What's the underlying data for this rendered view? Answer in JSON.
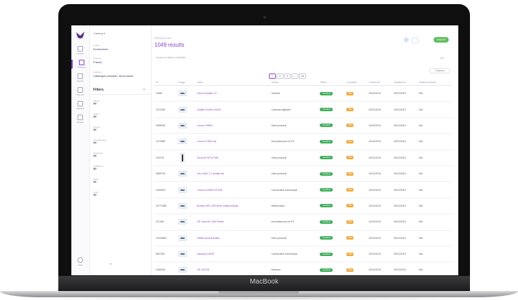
{
  "device": {
    "brand": "MacBook"
  },
  "rail": {
    "items": [
      {
        "label": "Activity",
        "icon": "activity-icon"
      },
      {
        "label": "Products",
        "icon": "products-icon"
      },
      {
        "label": "Imports",
        "icon": "imports-icon"
      },
      {
        "label": "Exports",
        "icon": "exports-icon"
      },
      {
        "label": "Settings",
        "icon": "gear-icon"
      },
      {
        "label": "System",
        "icon": "system-icon"
      }
    ],
    "help": "Help"
  },
  "sidebar": {
    "catalog": "Catalog",
    "locale_label": "Locale",
    "locale_value": "Ecommerce",
    "channel_label": "Channel",
    "channel_value": "France",
    "category_label": "Category",
    "category_value": "Catalogue principal / All products",
    "filters_title": "Filters",
    "filters_reset": "✕",
    "filters": [
      {
        "name": "Family",
        "value": "All"
      },
      {
        "name": "Status",
        "value": "All"
      },
      {
        "name": "Groups",
        "value": "All"
      },
      {
        "name": "Completeness",
        "value": "All"
      },
      {
        "name": "Created at",
        "value": "All"
      },
      {
        "name": "Updated at",
        "value": "All"
      },
      {
        "name": "Label",
        "value": "All"
      },
      {
        "name": "Color",
        "value": "All"
      }
    ]
  },
  "header": {
    "breadcrumb": "PRODUCTS",
    "results": "1049 results",
    "create_label": "CREATE",
    "search_placeholder": "Search on label or identifier",
    "locale": "EN",
    "columns_label": "Columns",
    "pages": [
      "1",
      "2",
      "3",
      "...",
      "44"
    ]
  },
  "table": {
    "columns": [
      "ID",
      "Image",
      "Label",
      "Family",
      "Status",
      "Complete",
      "Created at",
      "Updated at",
      "Variant products"
    ],
    "rows": [
      {
        "id": "19587",
        "label": "Sony Docsillon C2",
        "family": "Scanner",
        "status": "Enabled",
        "complete": "28%",
        "created": "09/12/2019",
        "updated": "09/12/2019",
        "variant": "N/A",
        "thumb": "wide"
      },
      {
        "id": "1372284",
        "label": "Fujifilm FinePix S4200",
        "family": "Cameras digitales",
        "status": "Enabled",
        "complete": "28%",
        "created": "09/12/2019",
        "updated": "09/12/2019",
        "variant": "N/A",
        "thumb": "wide"
      },
      {
        "id": "9356255",
        "label": "Lenovo V560X",
        "family": "Hard products",
        "status": "Enabled",
        "complete": "28%",
        "created": "09/12/2019",
        "updated": "09/12/2019",
        "variant": "N/A",
        "thumb": "wide"
      },
      {
        "id": "1374380",
        "label": "Lenovo E.550 Lite",
        "family": "Innovation pen for PC",
        "status": "Enabled",
        "complete": "28%",
        "created": "09/12/2019",
        "updated": "09/12/2019",
        "variant": "N/A",
        "thumb": "wide"
      },
      {
        "id": "132278",
        "label": "Sony SE-SP1XT4W",
        "family": "Hard products",
        "status": "Enabled",
        "complete": "28%",
        "created": "09/12/2019",
        "updated": "09/12/2019",
        "variant": "N/A",
        "thumb": "tall"
      },
      {
        "id": "9089703",
        "label": "Zero 400e 2.1 double-del",
        "family": "Hard products",
        "status": "Enabled",
        "complete": "28%",
        "created": "09/12/2019",
        "updated": "09/12/2019",
        "variant": "N/A",
        "thumb": "wide"
      },
      {
        "id": "1360533",
        "label": "Canon LEGRIA HF R32",
        "family": "Camcorders caméscope",
        "status": "Enabled",
        "complete": "28%",
        "created": "09/12/2019",
        "updated": "09/12/2019",
        "variant": "N/A",
        "thumb": "wide"
      },
      {
        "id": "10773358",
        "label": "Brother MFC-J5910DW multifunctional",
        "family": "Multifunction",
        "status": "Enabled",
        "complete": "28%",
        "created": "09/12/2019",
        "updated": "09/12/2019",
        "variant": "N/A",
        "thumb": "wide"
      },
      {
        "id": "137469",
        "label": "HP LaserJet 1160 Printer",
        "family": "Innovation pen for PC",
        "status": "Enabled",
        "complete": "28%",
        "created": "09/12/2019",
        "updated": "09/12/2019",
        "variant": "N/A",
        "thumb": "wide"
      },
      {
        "id": "13440849",
        "label": "DIMM Quad-Bundled",
        "family": "Hard products",
        "status": "Enabled",
        "complete": "28%",
        "created": "09/12/2019",
        "updated": "09/12/2019",
        "variant": "N/A",
        "thumb": "wide"
      },
      {
        "id": "9627801",
        "label": "Ideastop 100UP",
        "family": "Camcorders caméscope",
        "status": "Enabled",
        "complete": "28%",
        "created": "09/12/2019",
        "updated": "09/12/2019",
        "variant": "N/A",
        "thumb": "wide"
      },
      {
        "id": "1360039",
        "label": "HP LD4700",
        "family": "Monitors",
        "status": "Enabled",
        "complete": "28%",
        "created": "09/12/2019",
        "updated": "09/12/2019",
        "variant": "N/A",
        "thumb": "wide"
      }
    ]
  },
  "colors": {
    "accent": "#8a45c9",
    "success": "#3fae5a",
    "warning": "#f0a93b",
    "create": "#5cbd5b"
  }
}
